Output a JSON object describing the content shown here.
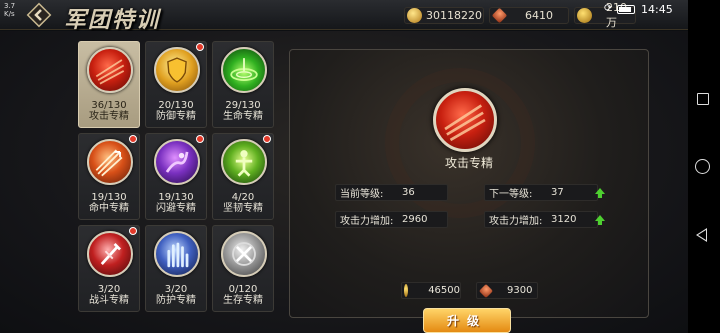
{
  "header": {
    "title": "军团特训",
    "status_speed": "3.7",
    "status_unit": "K/s",
    "resources": [
      {
        "name": "gold",
        "icon": "gold-ingot-icon",
        "value": "30118220"
      },
      {
        "name": "star",
        "icon": "star-badge-icon",
        "value": "6410"
      },
      {
        "name": "coin",
        "icon": "coin-icon",
        "value": "210万"
      }
    ],
    "time": "14:45"
  },
  "skills": [
    {
      "id": "attack",
      "icon": "attack-orb-icon",
      "count": "36/130",
      "name": "攻击专精",
      "selected": true,
      "badge": false
    },
    {
      "id": "defense",
      "icon": "shield-orb-icon",
      "count": "20/130",
      "name": "防御专精",
      "selected": false,
      "badge": true
    },
    {
      "id": "life",
      "icon": "life-orb-icon",
      "count": "29/130",
      "name": "生命专精",
      "selected": false,
      "badge": false
    },
    {
      "id": "hit",
      "icon": "arrows-orb-icon",
      "count": "19/130",
      "name": "命中专精",
      "selected": false,
      "badge": true
    },
    {
      "id": "dodge",
      "icon": "dodge-orb-icon",
      "count": "19/130",
      "name": "闪避专精",
      "selected": false,
      "badge": true
    },
    {
      "id": "tough",
      "icon": "tough-orb-icon",
      "count": "4/20",
      "name": "坚韧专精",
      "selected": false,
      "badge": true
    },
    {
      "id": "battle",
      "icon": "battle-orb-icon",
      "count": "3/20",
      "name": "战斗专精",
      "selected": false,
      "badge": true
    },
    {
      "id": "guard",
      "icon": "guard-orb-icon",
      "count": "3/20",
      "name": "防护专精",
      "selected": false,
      "badge": false
    },
    {
      "id": "survive",
      "icon": "survive-orb-icon",
      "count": "0/120",
      "name": "生存专精",
      "selected": false,
      "badge": false
    }
  ],
  "detail": {
    "name": "攻击专精",
    "current_level_label": "当前等级:",
    "current_level": "36",
    "next_level_label": "下一等级:",
    "next_level": "37",
    "current_bonus_label": "攻击力增加:",
    "current_bonus": "2960",
    "next_bonus_label": "攻击力增加:",
    "next_bonus": "3120",
    "cost_gold": "46500",
    "cost_star": "9300",
    "upgrade_label": "升级"
  },
  "colors": {
    "accent": "#e48a12",
    "badge": "#e23a2a",
    "up_arrow": "#4ed030"
  }
}
